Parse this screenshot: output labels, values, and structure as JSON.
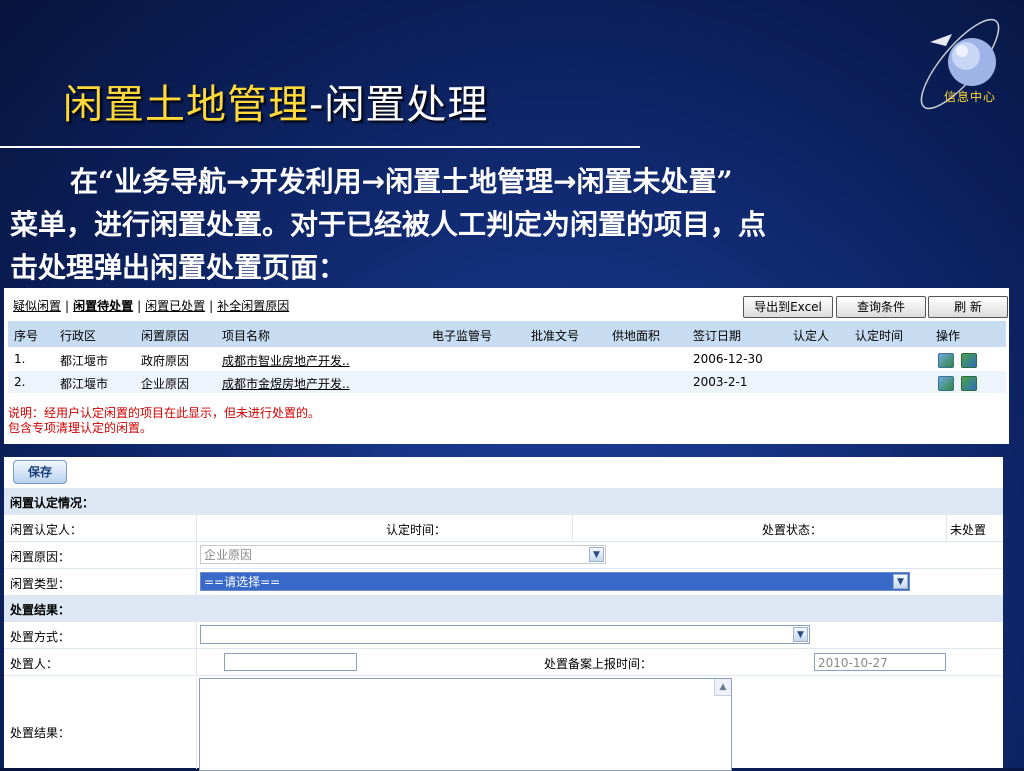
{
  "slide": {
    "title_main": "闲置土地管理",
    "title_sep": "-",
    "title_sub": "闲置处理",
    "logo_text": "信息中心",
    "intro": {
      "line1_a": "在“业务导航",
      "line1_b": "开发利用",
      "line1_c": "闲置土地管理",
      "line1_d": "闲置未处置”",
      "arrow": "→",
      "line2": "菜单，进行闲置处置。对于已经被人工判定为闲置的项目，点",
      "line3": "击处理弹出闲置处置页面："
    }
  },
  "list_panel": {
    "tabs": [
      "疑似闲置",
      "闲置待处置",
      "闲置已处置",
      "补全闲置原因"
    ],
    "tab_separator": "|",
    "buttons": {
      "export": "导出到Excel",
      "query": "查询条件",
      "refresh": "刷 新"
    },
    "columns": [
      "序号",
      "行政区",
      "闲置原因",
      "项目名称",
      "电子监管号",
      "批准文号",
      "供地面积",
      "签订日期",
      "认定人",
      "认定时间",
      "操作"
    ],
    "rows": [
      {
        "index": "1.",
        "district": "都江堰市",
        "reason": "政府原因",
        "project": "成都市智业房地产开发..",
        "supervision_no": "",
        "approval_no": "",
        "area": "",
        "date": "2006-12-30",
        "person": "",
        "time": ""
      },
      {
        "index": "2.",
        "district": "都江堰市",
        "reason": "企业原因",
        "project": "成都市金煜房地产开发..",
        "supervision_no": "",
        "approval_no": "",
        "area": "",
        "date": "2003-2-1",
        "person": "",
        "time": ""
      }
    ],
    "note_line1": "说明：经用户认定闲置的项目在此显示，但未进行处置的。",
    "note_line2": "包含专项清理认定的闲置。"
  },
  "form_panel": {
    "save_label": "保存",
    "section1_title": "闲置认定情况：",
    "label_identifier": "闲置认定人：",
    "label_identify_time": "认定时间：",
    "label_status": "处置状态：",
    "value_status": "未处置",
    "label_reason": "闲置原因：",
    "value_reason": "企业原因",
    "label_type": "闲置类型：",
    "value_type": "==请选择==",
    "section2_title": "处置结果：",
    "label_method": "处置方式：",
    "value_method": "",
    "label_handler": "处置人：",
    "value_handler": "",
    "label_report_time": "处置备案上报时间：",
    "value_report_time": "2010-10-27",
    "label_result": "处置结果：",
    "value_result": ""
  }
}
